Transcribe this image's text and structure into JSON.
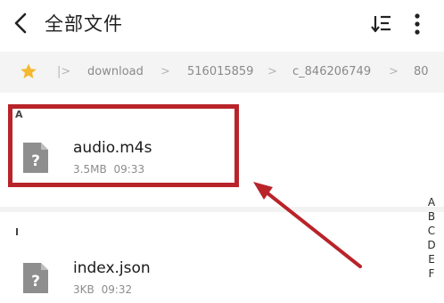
{
  "header": {
    "title": "全部文件",
    "back_icon": "chevron-left-icon",
    "sort_icon": "sort-icon",
    "more_icon": "more-vertical-icon"
  },
  "breadcrumb": {
    "star_icon": "star-icon",
    "star_color": "#f5b82e",
    "items": [
      "download",
      "516015859",
      "c_846206749",
      "80"
    ]
  },
  "sections": [
    {
      "letter": "A",
      "files": [
        {
          "name": "audio.m4s",
          "size": "3.5MB",
          "time": "09:33",
          "icon": "unknown-file-icon"
        }
      ]
    },
    {
      "letter": "I",
      "files": [
        {
          "name": "index.json",
          "size": "3KB",
          "time": "09:32",
          "icon": "unknown-file-icon"
        }
      ]
    }
  ],
  "alphabet_index": [
    "A",
    "B",
    "C",
    "D",
    "E",
    "F"
  ],
  "annotation": {
    "color": "#b8242a"
  }
}
